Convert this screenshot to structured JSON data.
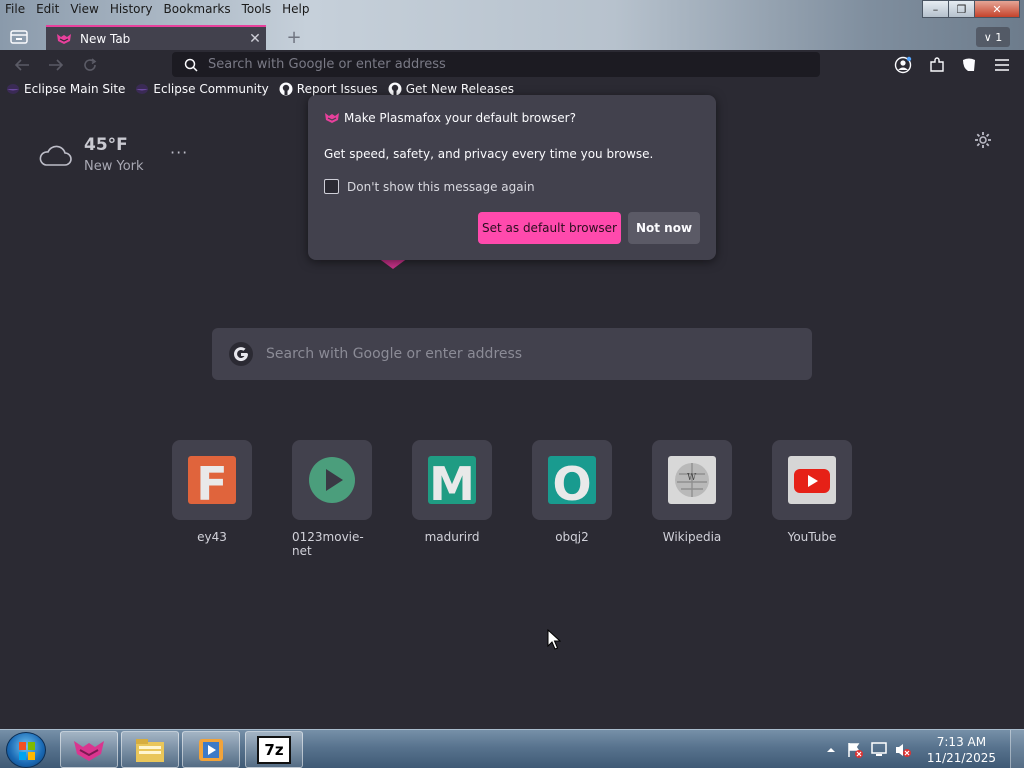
{
  "menu": [
    "File",
    "Edit",
    "View",
    "History",
    "Bookmarks",
    "Tools",
    "Help"
  ],
  "window_controls": {
    "minimize": "–",
    "maximize": "❐",
    "close": "✕"
  },
  "tab": {
    "title": "New Tab",
    "close": "✕"
  },
  "new_tab": "+",
  "tab_count": "∨ 1",
  "urlbar": {
    "placeholder": "Search with Google or enter address"
  },
  "bookmarks": [
    {
      "label": "Eclipse Main Site",
      "icon": "eclipse-icon"
    },
    {
      "label": "Eclipse Community",
      "icon": "eclipse-icon"
    },
    {
      "label": "Report Issues",
      "icon": "github-icon"
    },
    {
      "label": "Get New Releases",
      "icon": "github-icon"
    }
  ],
  "weather": {
    "temp": "45°F",
    "city": "New York",
    "menu": "···",
    "icon": "cloud-icon"
  },
  "search": {
    "placeholder": "Search with Google or enter address"
  },
  "top_sites": [
    {
      "label": "ey43",
      "letter": "F",
      "color": "#e0643c"
    },
    {
      "label": "0123movie-net",
      "letter": "",
      "color": "#4b9e7c",
      "icon": "play-icon"
    },
    {
      "label": "madurird",
      "letter": "M",
      "color": "#1f9c83"
    },
    {
      "label": "obqj2",
      "letter": "O",
      "color": "#199b8f"
    },
    {
      "label": "Wikipedia",
      "letter": "",
      "color": "#d8d8d8",
      "icon": "wikipedia-globe-icon"
    },
    {
      "label": "YouTube",
      "letter": "",
      "color": "#d6d6d6",
      "icon": "youtube-icon"
    }
  ],
  "popup": {
    "title": "Make Plasmafox your default browser?",
    "body": "Get speed, safety, and privacy every time you browse.",
    "checkbox_label": "Don't show this message again",
    "primary": "Set as default browser",
    "secondary": "Not now"
  },
  "taskbar": {
    "apps": [
      "plasmafox-icon",
      "file-explorer-icon",
      "media-player-icon",
      "7zip-icon"
    ],
    "seven_zip_label": "7z",
    "time": "7:13 AM",
    "date": "11/21/2025"
  },
  "colors": {
    "accent": "#ff4aad",
    "background": "#2b2a33",
    "surface": "#42414d"
  }
}
